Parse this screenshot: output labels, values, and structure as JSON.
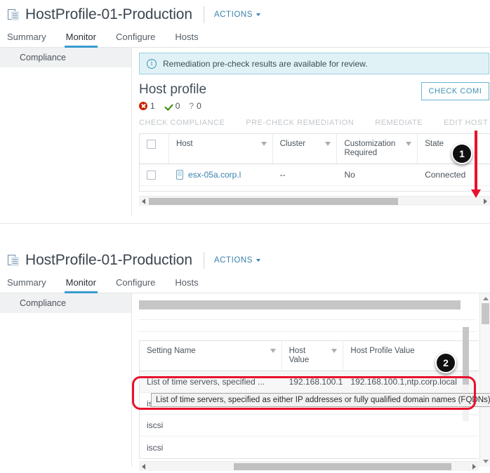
{
  "panel1": {
    "header": {
      "title": "HostProfile-01-Production",
      "actions_label": "ACTIONS",
      "icon": "host-profile-icon"
    },
    "tabs": [
      {
        "label": "Summary",
        "active": false
      },
      {
        "label": "Monitor",
        "active": true
      },
      {
        "label": "Configure",
        "active": false
      },
      {
        "label": "Hosts",
        "active": false
      }
    ],
    "sidebar": {
      "items": [
        {
          "label": "Compliance",
          "selected": true
        }
      ]
    },
    "alert": {
      "icon": "info-icon",
      "text": "Remediation pre-check results are available for review."
    },
    "section": {
      "title": "Host profile",
      "status": [
        {
          "icon": "error-icon",
          "count": "1"
        },
        {
          "icon": "check-icon",
          "count": "0"
        },
        {
          "icon": "question-icon",
          "count": "0"
        }
      ],
      "primary_button": "CHECK COMI"
    },
    "toolbar": [
      "CHECK COMPLIANCE",
      "PRE-CHECK REMEDIATION",
      "REMEDIATE",
      "EDIT HOST CU"
    ],
    "table": {
      "columns": [
        "Host",
        "Cluster",
        "Customization Required",
        "State"
      ],
      "rows": [
        {
          "host": "esx-05a.corp.l",
          "cluster": "--",
          "customization_required": "No",
          "state": "Connected"
        }
      ]
    },
    "callout": "1"
  },
  "panel2": {
    "header": {
      "title": "HostProfile-01-Production",
      "actions_label": "ACTIONS",
      "icon": "host-profile-icon"
    },
    "tabs": [
      {
        "label": "Summary",
        "active": false
      },
      {
        "label": "Monitor",
        "active": true
      },
      {
        "label": "Configure",
        "active": false
      },
      {
        "label": "Hosts",
        "active": false
      }
    ],
    "sidebar": {
      "items": [
        {
          "label": "Compliance",
          "selected": true
        }
      ]
    },
    "table": {
      "columns": [
        "Setting Name",
        "Host Value",
        "Host Profile Value"
      ],
      "rows": [
        {
          "setting_name": "List of time servers, specified ...",
          "host_value": "192.168.100.1",
          "host_profile_value": "192.168.100.1,ntp.corp.local"
        },
        {
          "setting_name": "iscsi",
          "host_value": "",
          "host_profile_value": ""
        },
        {
          "setting_name": "iscsi",
          "host_value": "",
          "host_profile_value": ""
        },
        {
          "setting_name": "iscsi",
          "host_value": "",
          "host_profile_value": ""
        }
      ]
    },
    "tooltip": "List of time servers, specified as either IP addresses or fully qualified domain names (FQDNs).",
    "callout": "2"
  },
  "colors": {
    "accent_blue": "#3881ae",
    "tab_underline": "#3a9bd0",
    "alert_bg": "#e1f2f7",
    "alert_border": "#9cd0e0",
    "error_red": "#c92100",
    "ok_green": "#318700",
    "annotation_red": "#e8112d",
    "callout_black": "#101010"
  }
}
